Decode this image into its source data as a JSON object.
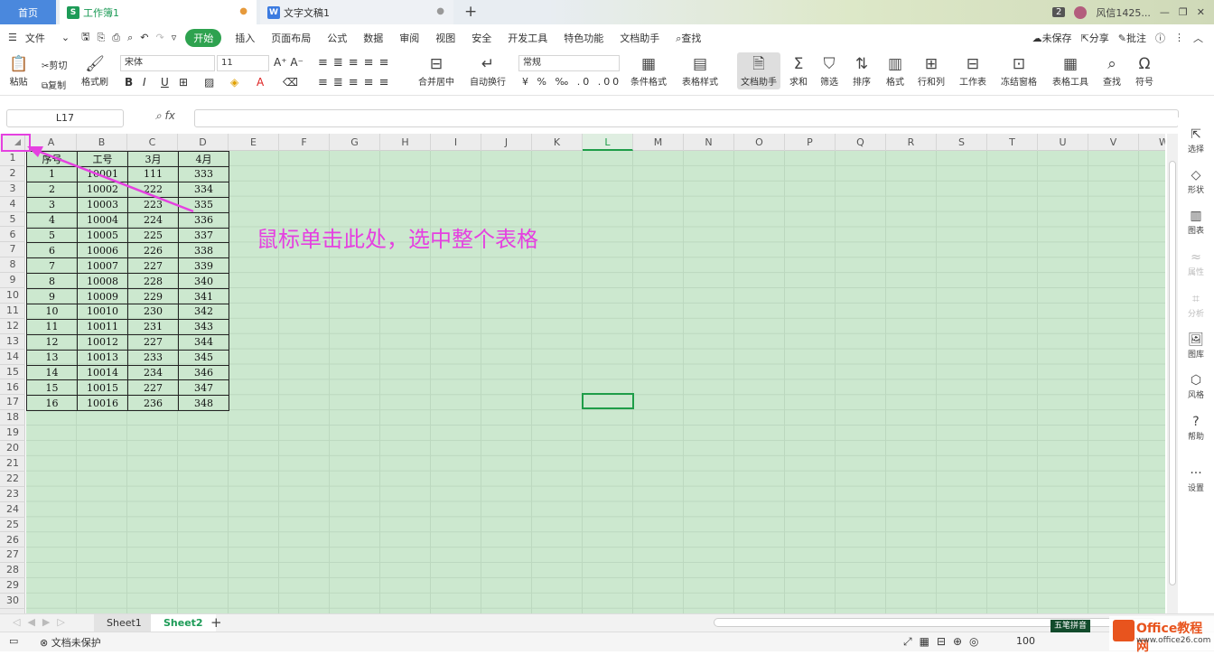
{
  "tabs": {
    "home": "首页",
    "workbook": "工作簿1",
    "document": "文字文稿1",
    "plus": "+"
  },
  "window": {
    "badge": "2",
    "user": "风信1425...",
    "min": "—",
    "restore": "❐",
    "close": "✕"
  },
  "menu": {
    "file": "文件",
    "items": [
      "开始",
      "插入",
      "页面布局",
      "公式",
      "数据",
      "审阅",
      "视图",
      "安全",
      "开发工具",
      "特色功能",
      "文档助手"
    ],
    "search": "查找",
    "unsaved": "未保存",
    "share": "分享",
    "comment": "批注"
  },
  "ribbon": {
    "paste": "粘贴",
    "cut": "剪切",
    "copy": "复制",
    "format_painter": "格式刷",
    "font_name": "宋体",
    "font_size": "11",
    "merge": "合并居中",
    "wrap": "自动换行",
    "number_format": "常规",
    "cond_format": "条件格式",
    "table_style": "表格样式",
    "doc_helper": "文档助手",
    "sum": "求和",
    "filter": "筛选",
    "sort": "排序",
    "format": "格式",
    "rowcol": "行和列",
    "worksheet": "工作表",
    "freeze": "冻结窗格",
    "table_tools": "表格工具",
    "find": "查找",
    "symbol": "符号"
  },
  "formula_bar": {
    "cell_ref": "L17",
    "fx": "fx",
    "value": ""
  },
  "columns": [
    "A",
    "B",
    "C",
    "D",
    "E",
    "F",
    "G",
    "H",
    "I",
    "J",
    "K",
    "L",
    "M",
    "N",
    "O",
    "P",
    "Q",
    "R",
    "S",
    "T",
    "U",
    "V",
    "W"
  ],
  "rows": [
    "1",
    "2",
    "3",
    "4",
    "5",
    "6",
    "7",
    "8",
    "9",
    "10",
    "11",
    "12",
    "13",
    "14",
    "15",
    "16",
    "17",
    "18",
    "19",
    "20",
    "21",
    "22",
    "23",
    "24",
    "25",
    "26",
    "27",
    "28",
    "29",
    "30"
  ],
  "table": {
    "headers": [
      "序号",
      "工号",
      "3月",
      "4月"
    ],
    "rows": [
      [
        "1",
        "10001",
        "111",
        "333"
      ],
      [
        "2",
        "10002",
        "222",
        "334"
      ],
      [
        "3",
        "10003",
        "223",
        "335"
      ],
      [
        "4",
        "10004",
        "224",
        "336"
      ],
      [
        "5",
        "10005",
        "225",
        "337"
      ],
      [
        "6",
        "10006",
        "226",
        "338"
      ],
      [
        "7",
        "10007",
        "227",
        "339"
      ],
      [
        "8",
        "10008",
        "228",
        "340"
      ],
      [
        "9",
        "10009",
        "229",
        "341"
      ],
      [
        "10",
        "10010",
        "230",
        "342"
      ],
      [
        "11",
        "10011",
        "231",
        "343"
      ],
      [
        "12",
        "10012",
        "227",
        "344"
      ],
      [
        "13",
        "10013",
        "233",
        "345"
      ],
      [
        "14",
        "10014",
        "234",
        "346"
      ],
      [
        "15",
        "10015",
        "227",
        "347"
      ],
      [
        "16",
        "10016",
        "236",
        "348"
      ]
    ]
  },
  "annotation": "鼠标单击此处，选中整个表格",
  "sidebar": [
    "选择",
    "形状",
    "图表",
    "属性",
    "分析",
    "图库",
    "风格",
    "帮助",
    "设置"
  ],
  "sheets": [
    "Sheet1",
    "Sheet2"
  ],
  "status": {
    "protect": "文档未保护",
    "zoom": "100",
    "ime": "五笔拼音"
  },
  "watermark": {
    "title": "Office教程网",
    "url": "www.office26.com"
  },
  "colors": {
    "accent": "#2ea24f",
    "annotation": "#e541e0",
    "grid_bg": "#cce8cf"
  }
}
